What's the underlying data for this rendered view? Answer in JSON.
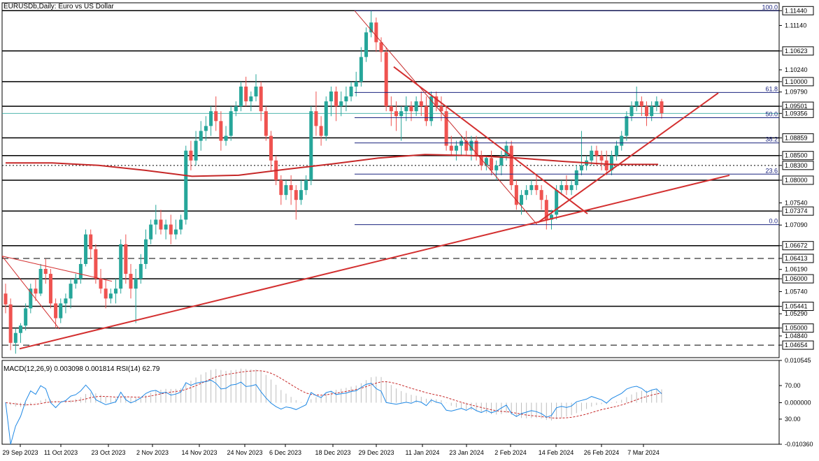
{
  "chart_data": {
    "type": "candlestick",
    "title": "EURUSDb,Daily: Euro vs US Dollar",
    "indicator_label": "MACD(12,26,9) 0.003098 0.001814 RSI(14) 62.79",
    "price_axis": {
      "ylim": [
        1.044,
        1.116
      ],
      "ticks": [
        "1.11440",
        "1.11140",
        "1.10623",
        "1.10240",
        "1.10000",
        "1.09790",
        "1.09501",
        "1.09356",
        "1.08859",
        "1.08500",
        "1.08300",
        "1.08000",
        "1.07540",
        "1.07374",
        "1.07090",
        "1.06672",
        "1.06413",
        "1.06190",
        "1.06000",
        "1.05740",
        "1.05441",
        "1.05290",
        "1.05000",
        "1.04840",
        "1.04654"
      ],
      "boxed": [
        "1.11440",
        "1.10623",
        "1.10000",
        "1.09501",
        "1.09356",
        "1.08859",
        "1.08500",
        "1.08300",
        "1.08000",
        "1.07374",
        "1.06672",
        "1.06413",
        "1.06000",
        "1.05441",
        "1.05000",
        "1.04654"
      ],
      "current_price": "1.09356"
    },
    "x_labels": [
      "29 Sep 2023",
      "11 Oct 2023",
      "23 Oct 2023",
      "2 Nov 2023",
      "14 Nov 2023",
      "24 Nov 2023",
      "6 Dec 2023",
      "18 Dec 2023",
      "29 Dec 2023",
      "11 Jan 2024",
      "23 Jan 2024",
      "2 Feb 2024",
      "14 Feb 2024",
      "26 Feb 2024",
      "7 Mar 2024"
    ],
    "horizontal_levels": [
      {
        "price": 1.1144,
        "style": "solid"
      },
      {
        "price": 1.10623,
        "style": "solid"
      },
      {
        "price": 1.1,
        "style": "solid"
      },
      {
        "price": 1.09501,
        "style": "solid"
      },
      {
        "price": 1.08859,
        "style": "solid"
      },
      {
        "price": 1.085,
        "style": "solid"
      },
      {
        "price": 1.083,
        "style": "dashed"
      },
      {
        "price": 1.08,
        "style": "solid"
      },
      {
        "price": 1.07374,
        "style": "solid"
      },
      {
        "price": 1.06672,
        "style": "solid"
      },
      {
        "price": 1.06413,
        "style": "dashed"
      },
      {
        "price": 1.06,
        "style": "solid"
      },
      {
        "price": 1.05441,
        "style": "solid"
      },
      {
        "price": 1.05,
        "style": "solid"
      },
      {
        "price": 1.04654,
        "style": "dashed"
      }
    ],
    "fibonacci": [
      {
        "label": "100.0",
        "price": 1.1144
      },
      {
        "label": "61.8",
        "price": 1.09781
      },
      {
        "label": "50.0",
        "price": 1.09269
      },
      {
        "label": "38.2",
        "price": 1.08757
      },
      {
        "label": "23.6",
        "price": 1.08124
      },
      {
        "label": "0.0",
        "price": 1.07099
      }
    ],
    "candles": [
      [
        1.057,
        1.059,
        1.053,
        1.0548
      ],
      [
        1.0548,
        1.056,
        1.0455,
        1.047
      ],
      [
        1.047,
        1.05,
        1.0448,
        1.049
      ],
      [
        1.049,
        1.051,
        1.047,
        1.0505
      ],
      [
        1.0505,
        1.055,
        1.0495,
        1.054
      ],
      [
        1.054,
        1.059,
        1.053,
        1.058
      ],
      [
        1.058,
        1.06,
        1.0555,
        1.057
      ],
      [
        1.057,
        1.063,
        1.0565,
        1.062
      ],
      [
        1.062,
        1.064,
        1.059,
        1.061
      ],
      [
        1.061,
        1.062,
        1.054,
        1.055
      ],
      [
        1.055,
        1.056,
        1.05,
        1.052
      ],
      [
        1.052,
        1.056,
        1.051,
        1.055
      ],
      [
        1.055,
        1.057,
        1.053,
        1.056
      ],
      [
        1.056,
        1.06,
        1.054,
        1.059
      ],
      [
        1.059,
        1.061,
        1.058,
        1.06
      ],
      [
        1.06,
        1.064,
        1.059,
        1.063
      ],
      [
        1.063,
        1.07,
        1.0625,
        1.069
      ],
      [
        1.069,
        1.07,
        1.064,
        1.066
      ],
      [
        1.066,
        1.067,
        1.059,
        1.06
      ],
      [
        1.06,
        1.062,
        1.057,
        1.058
      ],
      [
        1.058,
        1.06,
        1.054,
        1.056
      ],
      [
        1.056,
        1.058,
        1.055,
        1.057
      ],
      [
        1.057,
        1.06,
        1.055,
        1.058
      ],
      [
        1.058,
        1.068,
        1.057,
        1.067
      ],
      [
        1.067,
        1.069,
        1.059,
        1.061
      ],
      [
        1.061,
        1.063,
        1.056,
        1.058
      ],
      [
        1.058,
        1.062,
        1.051,
        1.06
      ],
      [
        1.06,
        1.065,
        1.059,
        1.063
      ],
      [
        1.063,
        1.07,
        1.062,
        1.068
      ],
      [
        1.068,
        1.072,
        1.067,
        1.071
      ],
      [
        1.071,
        1.075,
        1.069,
        1.072
      ],
      [
        1.072,
        1.074,
        1.069,
        1.07
      ],
      [
        1.07,
        1.072,
        1.068,
        1.071
      ],
      [
        1.071,
        1.073,
        1.067,
        1.069
      ],
      [
        1.069,
        1.072,
        1.068,
        1.07
      ],
      [
        1.07,
        1.073,
        1.069,
        1.072
      ],
      [
        1.072,
        1.087,
        1.071,
        1.086
      ],
      [
        1.086,
        1.088,
        1.082,
        1.084
      ],
      [
        1.084,
        1.09,
        1.083,
        1.088
      ],
      [
        1.088,
        1.092,
        1.086,
        1.09
      ],
      [
        1.09,
        1.093,
        1.088,
        1.091
      ],
      [
        1.091,
        1.095,
        1.089,
        1.094
      ],
      [
        1.094,
        1.097,
        1.09,
        1.092
      ],
      [
        1.092,
        1.094,
        1.086,
        1.088
      ],
      [
        1.088,
        1.091,
        1.087,
        1.089
      ],
      [
        1.089,
        1.095,
        1.088,
        1.094
      ],
      [
        1.094,
        1.096,
        1.093,
        1.095
      ],
      [
        1.095,
        1.1,
        1.094,
        1.099
      ],
      [
        1.099,
        1.101,
        1.095,
        1.096
      ],
      [
        1.096,
        1.098,
        1.094,
        1.097
      ],
      [
        1.097,
        1.1015,
        1.096,
        1.099
      ],
      [
        1.099,
        1.1,
        1.092,
        1.094
      ],
      [
        1.094,
        1.095,
        1.088,
        1.089
      ],
      [
        1.089,
        1.09,
        1.082,
        1.084
      ],
      [
        1.084,
        1.085,
        1.079,
        1.08
      ],
      [
        1.08,
        1.081,
        1.075,
        1.077
      ],
      [
        1.077,
        1.08,
        1.076,
        1.079
      ],
      [
        1.079,
        1.081,
        1.075,
        1.078
      ],
      [
        1.078,
        1.079,
        1.072,
        1.076
      ],
      [
        1.076,
        1.08,
        1.075,
        1.078
      ],
      [
        1.078,
        1.081,
        1.077,
        1.08
      ],
      [
        1.08,
        1.095,
        1.079,
        1.094
      ],
      [
        1.094,
        1.098,
        1.089,
        1.091
      ],
      [
        1.091,
        1.093,
        1.087,
        1.089
      ],
      [
        1.089,
        1.097,
        1.088,
        1.096
      ],
      [
        1.096,
        1.099,
        1.093,
        1.098
      ],
      [
        1.098,
        1.099,
        1.092,
        1.095
      ],
      [
        1.095,
        1.098,
        1.093,
        1.096
      ],
      [
        1.096,
        1.099,
        1.094,
        1.097
      ],
      [
        1.097,
        1.1,
        1.096,
        1.099
      ],
      [
        1.099,
        1.102,
        1.097,
        1.1
      ],
      [
        1.1,
        1.107,
        1.099,
        1.105
      ],
      [
        1.105,
        1.111,
        1.104,
        1.11
      ],
      [
        1.11,
        1.1144,
        1.109,
        1.112
      ],
      [
        1.112,
        1.113,
        1.106,
        1.108
      ],
      [
        1.108,
        1.109,
        1.104,
        1.106
      ],
      [
        1.106,
        1.107,
        1.094,
        1.095
      ],
      [
        1.095,
        1.097,
        1.091,
        1.094
      ],
      [
        1.094,
        1.096,
        1.09,
        1.093
      ],
      [
        1.093,
        1.095,
        1.088,
        1.094
      ],
      [
        1.094,
        1.097,
        1.092,
        1.095
      ],
      [
        1.095,
        1.096,
        1.092,
        1.094
      ],
      [
        1.094,
        1.097,
        1.093,
        1.096
      ],
      [
        1.096,
        1.098,
        1.093,
        1.095
      ],
      [
        1.095,
        1.097,
        1.091,
        1.092
      ],
      [
        1.092,
        1.098,
        1.091,
        1.097
      ],
      [
        1.097,
        1.098,
        1.094,
        1.095
      ],
      [
        1.095,
        1.097,
        1.092,
        1.094
      ],
      [
        1.094,
        1.095,
        1.086,
        1.087
      ],
      [
        1.087,
        1.089,
        1.085,
        1.086
      ],
      [
        1.086,
        1.088,
        1.084,
        1.087
      ],
      [
        1.087,
        1.089,
        1.085,
        1.088
      ],
      [
        1.088,
        1.09,
        1.085,
        1.086
      ],
      [
        1.086,
        1.089,
        1.084,
        1.088
      ],
      [
        1.088,
        1.089,
        1.084,
        1.085
      ],
      [
        1.085,
        1.086,
        1.082,
        1.083
      ],
      [
        1.083,
        1.085,
        1.082,
        1.0845
      ],
      [
        1.0845,
        1.086,
        1.081,
        1.082
      ],
      [
        1.082,
        1.084,
        1.08,
        1.083
      ],
      [
        1.083,
        1.086,
        1.081,
        1.085
      ],
      [
        1.085,
        1.088,
        1.084,
        1.087
      ],
      [
        1.087,
        1.088,
        1.078,
        1.079
      ],
      [
        1.079,
        1.08,
        1.074,
        1.075
      ],
      [
        1.075,
        1.078,
        1.073,
        1.077
      ],
      [
        1.077,
        1.079,
        1.076,
        1.078
      ],
      [
        1.078,
        1.08,
        1.077,
        1.079
      ],
      [
        1.079,
        1.081,
        1.077,
        1.078
      ],
      [
        1.078,
        1.079,
        1.074,
        1.076
      ],
      [
        1.076,
        1.077,
        1.07,
        1.072
      ],
      [
        1.072,
        1.074,
        1.07,
        1.073
      ],
      [
        1.073,
        1.079,
        1.072,
        1.078
      ],
      [
        1.078,
        1.08,
        1.077,
        1.079
      ],
      [
        1.079,
        1.081,
        1.077,
        1.078
      ],
      [
        1.078,
        1.08,
        1.077,
        1.079
      ],
      [
        1.079,
        1.083,
        1.078,
        1.082
      ],
      [
        1.082,
        1.09,
        1.081,
        1.083
      ],
      [
        1.083,
        1.085,
        1.082,
        1.084
      ],
      [
        1.084,
        1.087,
        1.083,
        1.086
      ],
      [
        1.086,
        1.087,
        1.083,
        1.085
      ],
      [
        1.085,
        1.086,
        1.082,
        1.084
      ],
      [
        1.084,
        1.086,
        1.081,
        1.082
      ],
      [
        1.082,
        1.086,
        1.081,
        1.085
      ],
      [
        1.085,
        1.088,
        1.084,
        1.087
      ],
      [
        1.087,
        1.09,
        1.086,
        1.089
      ],
      [
        1.089,
        1.094,
        1.088,
        1.093
      ],
      [
        1.093,
        1.096,
        1.092,
        1.095
      ],
      [
        1.095,
        1.099,
        1.094,
        1.096
      ],
      [
        1.096,
        1.097,
        1.093,
        1.095
      ],
      [
        1.095,
        1.096,
        1.091,
        1.093
      ],
      [
        1.093,
        1.096,
        1.092,
        1.095
      ],
      [
        1.095,
        1.097,
        1.094,
        1.096
      ],
      [
        1.096,
        1.0965,
        1.0925,
        1.0936
      ]
    ],
    "ma_line": [
      [
        1.0835,
        0
      ],
      [
        1.0835,
        0.07
      ],
      [
        1.083,
        0.16
      ],
      [
        1.082,
        0.22
      ],
      [
        1.0808,
        0.26
      ],
      [
        1.081,
        0.29
      ],
      [
        1.0822,
        0.33
      ],
      [
        1.0833,
        0.37
      ],
      [
        1.0845,
        0.44
      ],
      [
        1.0852,
        0.52
      ],
      [
        1.085,
        0.58
      ],
      [
        1.0845,
        0.63
      ],
      [
        1.0838,
        0.68
      ],
      [
        1.0832,
        0.72
      ],
      [
        1.0832,
        0.78
      ]
    ],
    "macd": {
      "ylim": [
        -0.01036,
        0.010545
      ],
      "ticks": [
        "0.010545",
        "70.00",
        "0.000000",
        "30.00",
        "-0.010360"
      ]
    }
  }
}
